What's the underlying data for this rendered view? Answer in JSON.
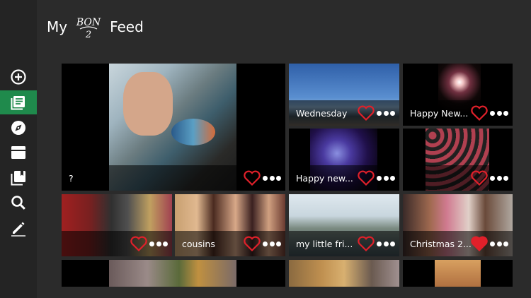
{
  "header": {
    "title_prefix": "My",
    "title_suffix": "Feed",
    "logo": {
      "top": "BON",
      "bottom": "2"
    }
  },
  "sidebar": {
    "items": [
      {
        "name": "add-icon",
        "active": false
      },
      {
        "name": "feed-icon",
        "active": true
      },
      {
        "name": "explore-compass-icon",
        "active": false
      },
      {
        "name": "card-icon",
        "active": false
      },
      {
        "name": "albums-icon",
        "active": false
      },
      {
        "name": "search-icon",
        "active": false
      },
      {
        "name": "edit-pencil-icon",
        "active": false
      }
    ]
  },
  "tiles": [
    {
      "caption": "?",
      "liked": false,
      "photo": "selfie with bowl"
    },
    {
      "caption": "Wednesday",
      "liked": false,
      "photo": "beach sky"
    },
    {
      "caption": "Happy New...",
      "liked": false,
      "photo": "fireworks"
    },
    {
      "caption": "Happy new...",
      "liked": false,
      "photo": "night lights"
    },
    {
      "caption": "",
      "liked": false,
      "photo": "ornaments"
    },
    {
      "caption": "",
      "liked": false,
      "photo": "three friends"
    },
    {
      "caption": "cousins",
      "liked": false,
      "photo": "three girls"
    },
    {
      "caption": "my little fri...",
      "liked": false,
      "photo": "boats"
    },
    {
      "caption": "Christmas 2...",
      "liked": true,
      "photo": "father and child"
    },
    {
      "caption": "",
      "liked": false,
      "photo": "trees"
    },
    {
      "caption": "",
      "liked": false,
      "photo": "figure"
    },
    {
      "caption": "",
      "liked": false,
      "photo": "warm light"
    }
  ],
  "colors": {
    "accent": "#1f8a4c",
    "heart": "#e0202a",
    "background": "#2b2b2b"
  }
}
